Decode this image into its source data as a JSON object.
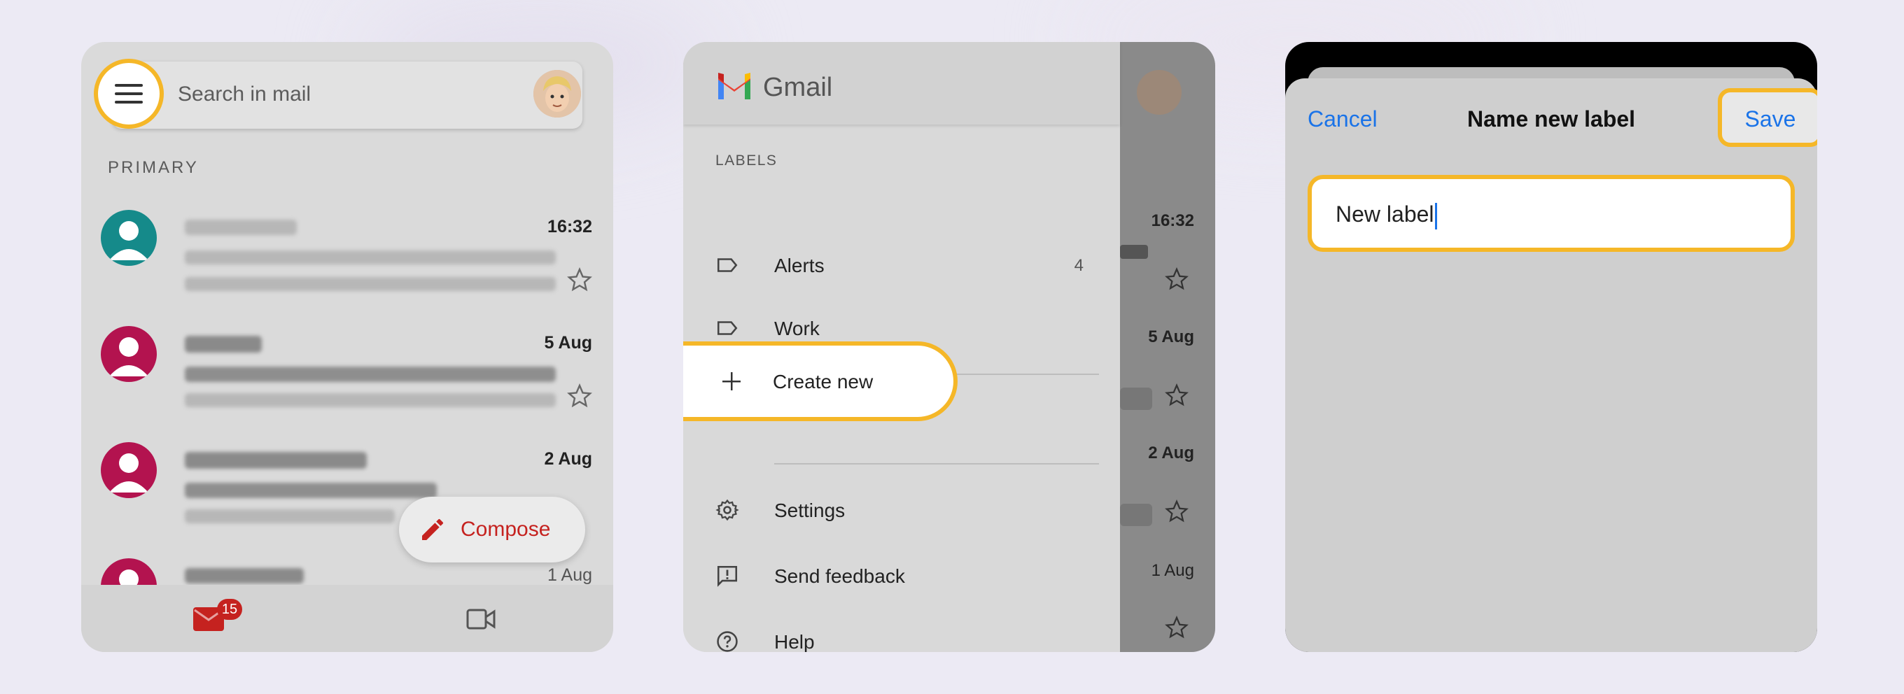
{
  "colors": {
    "highlight": "#f5b728",
    "link_blue": "#1a73e8",
    "gmail_red": "#c5221f"
  },
  "panel1": {
    "search_placeholder": "Search in mail",
    "section_label": "PRIMARY",
    "mails": [
      {
        "sender": "Moz Top 10",
        "date": "16:32",
        "avatar_color": "#158a8a"
      },
      {
        "sender": "Google",
        "date": "5 Aug",
        "avatar_color": "#b3134f"
      },
      {
        "sender": "Clean Email Team",
        "date": "2 Aug",
        "avatar_color": "#b3134f"
      },
      {
        "sender": "Moz Top 10",
        "date": "1 Aug",
        "avatar_color": "#b3134f"
      }
    ],
    "compose_label": "Compose",
    "mail_badge": "15"
  },
  "panel2": {
    "app_name": "Gmail",
    "labels_title": "LABELS",
    "labels": [
      {
        "label": "Alerts",
        "count": "4",
        "icon": "label-icon"
      },
      {
        "label": "Work",
        "count": "",
        "icon": "label-icon"
      }
    ],
    "create_new": "Create new",
    "menu": [
      {
        "label": "Settings",
        "icon": "gear-icon"
      },
      {
        "label": "Send feedback",
        "icon": "feedback-icon"
      },
      {
        "label": "Help",
        "icon": "help-icon"
      }
    ],
    "background_dates": [
      "16:32",
      "5 Aug",
      "2 Aug",
      "1 Aug"
    ]
  },
  "panel3": {
    "cancel": "Cancel",
    "title": "Name new label",
    "save": "Save",
    "input_value": "New label"
  }
}
